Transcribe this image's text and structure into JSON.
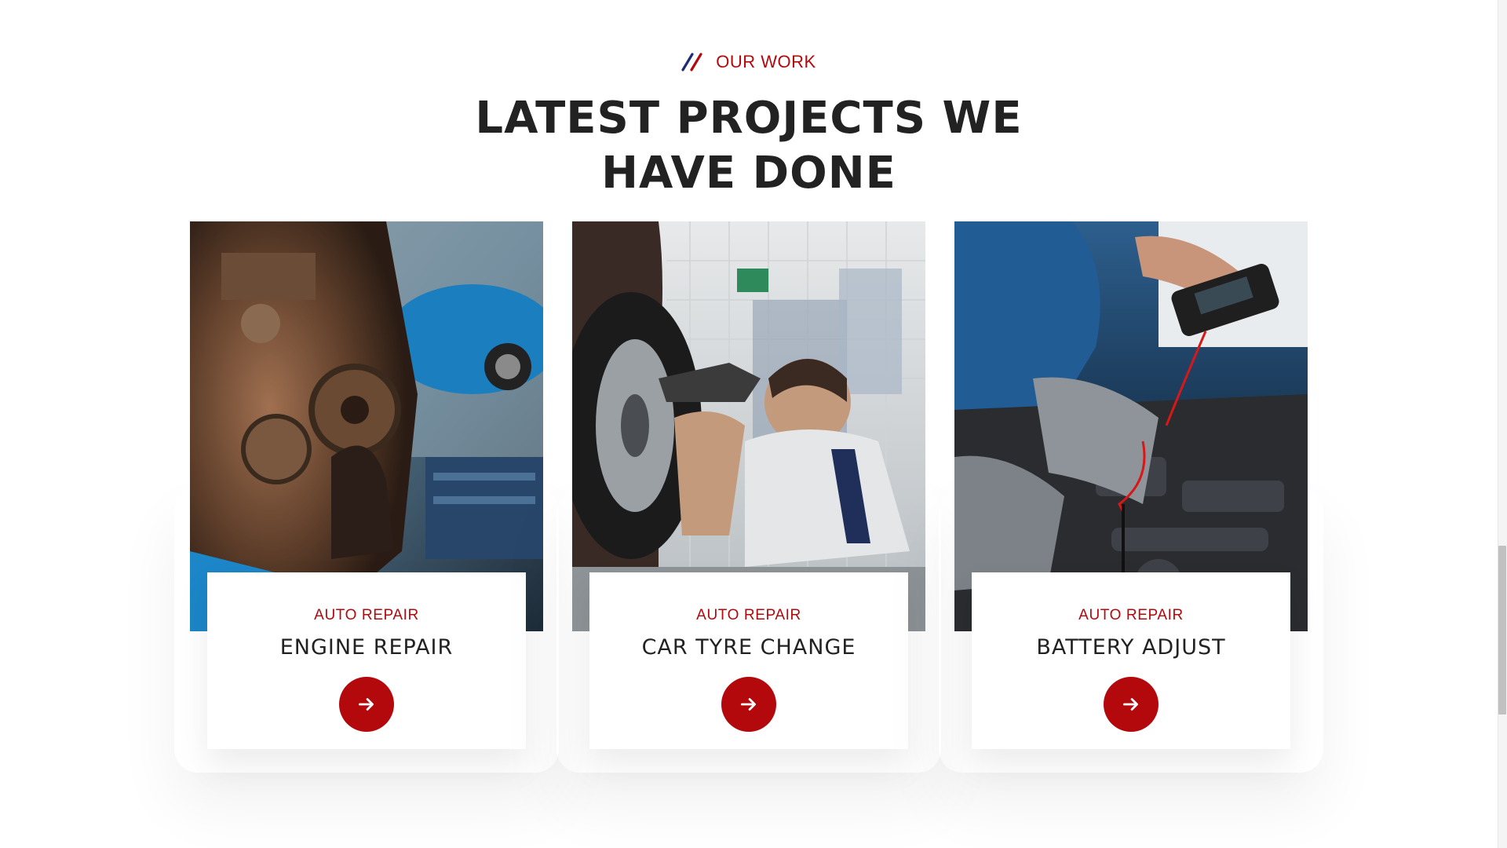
{
  "colors": {
    "accent": "#b3080c",
    "accent_secondary": "#1e2a78",
    "heading": "#222222",
    "background": "#ffffff"
  },
  "section": {
    "eyebrow": "OUR WORK",
    "title_line1": "LATEST PROJECTS WE",
    "title_line2": "HAVE DONE"
  },
  "projects": [
    {
      "category": "AUTO REPAIR",
      "title": "ENGINE REPAIR",
      "image": "engine-photo",
      "icon": "arrow-right-icon"
    },
    {
      "category": "AUTO REPAIR",
      "title": "CAR TYRE CHANGE",
      "image": "tyre-change-photo",
      "icon": "arrow-right-icon"
    },
    {
      "category": "AUTO REPAIR",
      "title": "BATTERY ADJUST",
      "image": "battery-test-photo",
      "icon": "arrow-right-icon"
    }
  ]
}
